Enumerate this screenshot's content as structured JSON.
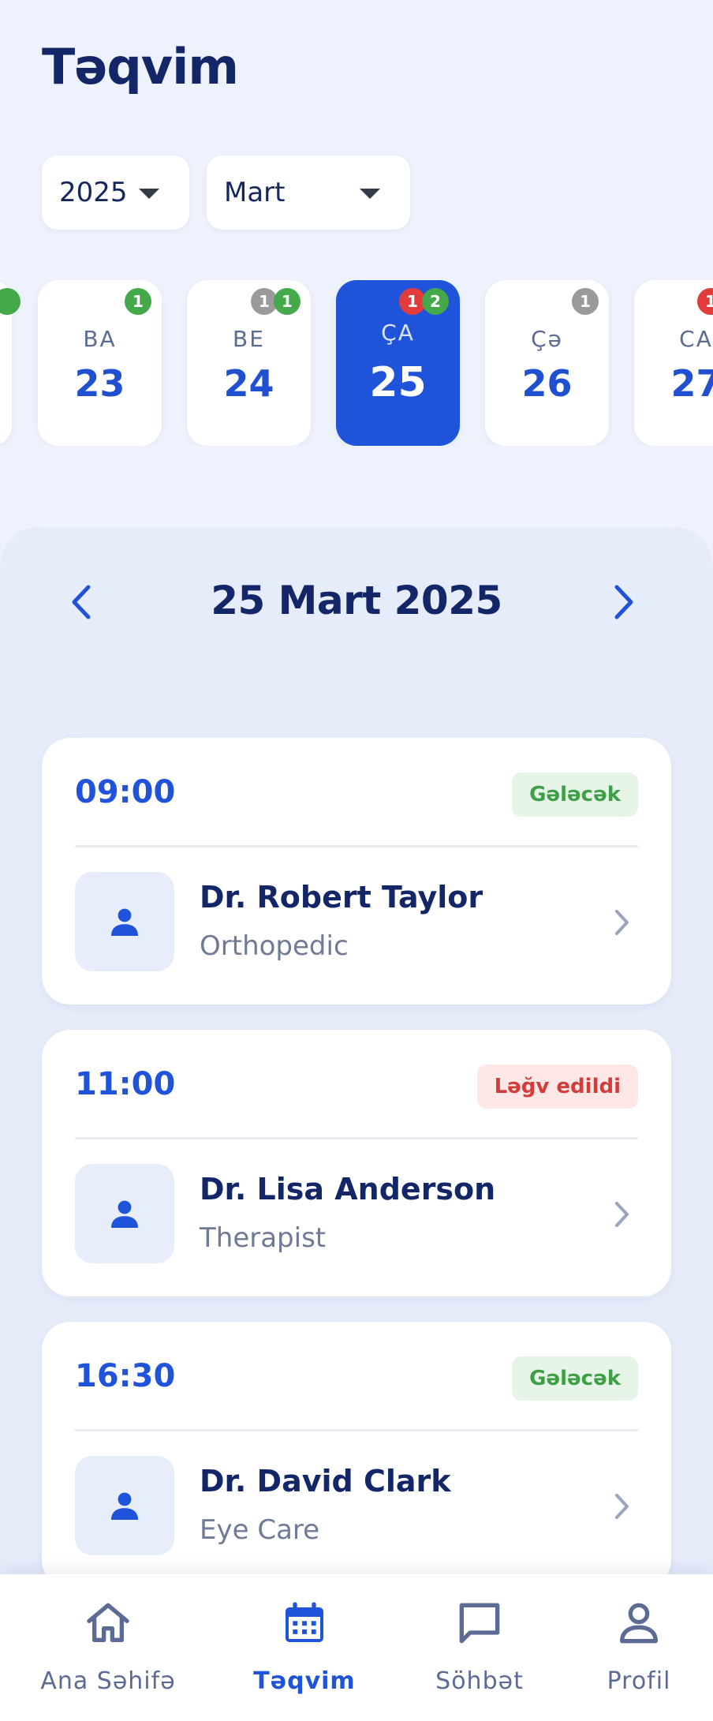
{
  "header": {
    "title": "Təqvim"
  },
  "filters": {
    "year": "2025",
    "month": "Mart"
  },
  "days": [
    {
      "weekday": "BA",
      "day": "23",
      "badges": [
        {
          "count": "1",
          "color": "green"
        }
      ]
    },
    {
      "weekday": "BE",
      "day": "24",
      "badges": [
        {
          "count": "1",
          "color": "grey"
        },
        {
          "count": "1",
          "color": "green"
        }
      ]
    },
    {
      "weekday": "ÇA",
      "day": "25",
      "selected": true,
      "badges": [
        {
          "count": "1",
          "color": "red"
        },
        {
          "count": "2",
          "color": "green"
        }
      ]
    },
    {
      "weekday": "Çə",
      "day": "26",
      "badges": [
        {
          "count": "1",
          "color": "grey"
        }
      ]
    },
    {
      "weekday": "CA",
      "day": "27",
      "badges": [
        {
          "count": "1",
          "color": "red"
        }
      ]
    }
  ],
  "date_heading": "25 Mart 2025",
  "appointments": [
    {
      "time": "09:00",
      "status": "Gələcək",
      "status_type": "upcoming",
      "doctor": "Dr. Robert Taylor",
      "specialty": "Orthopedic"
    },
    {
      "time": "11:00",
      "status": "Ləğv edildi",
      "status_type": "cancelled",
      "doctor": "Dr. Lisa Anderson",
      "specialty": "Therapist"
    },
    {
      "time": "16:30",
      "status": "Gələcək",
      "status_type": "upcoming",
      "doctor": "Dr. David Clark",
      "specialty": "Eye Care"
    }
  ],
  "nav": {
    "home": "Ana Səhifə",
    "calendar": "Təqvim",
    "chat": "Söhbət",
    "profile": "Profil"
  },
  "colors": {
    "accent": "#1f53d9",
    "title": "#132668",
    "background": "#eef2fc",
    "upcoming": "#3f9f46",
    "cancelled": "#d43c3c"
  }
}
